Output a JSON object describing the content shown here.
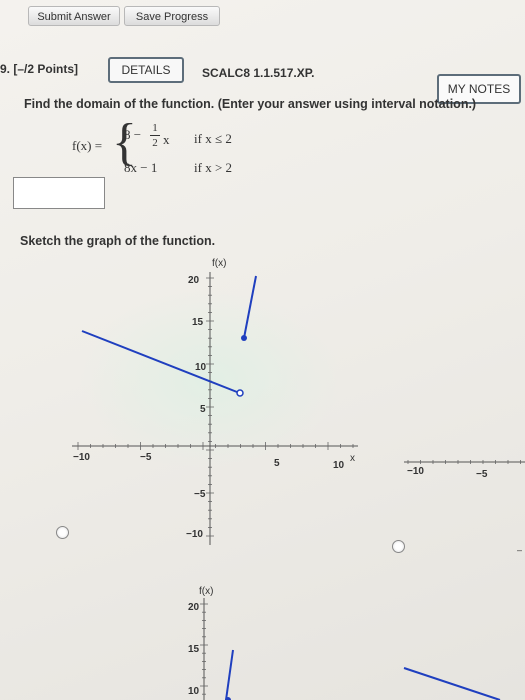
{
  "toolbar": {
    "submit_label": "Submit Answer",
    "save_label": "Save Progress"
  },
  "question": {
    "number": "9. [–/2 Points]",
    "details_label": "DETAILS",
    "code": "SCALC8 1.1.517.XP.",
    "my_notes_label": "MY NOTES",
    "prompt": "Find the domain of the function. (Enter your answer using interval notation.)",
    "function_name": "f(x) =",
    "piece1_expr": "8 −",
    "piece1_frac_num": "1",
    "piece1_frac_den": "2",
    "piece1_var": "x",
    "piece1_cond": "if x ≤ 2",
    "piece2_expr": "8x − 1",
    "piece2_cond": "if x > 2",
    "answer_value": "",
    "sketch_prompt": "Sketch the graph of the function."
  },
  "graph_main": {
    "ylabel": "f(x)",
    "xlabel": "x",
    "x_ticks": [
      "−10",
      "−5",
      "5",
      "10"
    ],
    "y_ticks": [
      "20",
      "15",
      "10",
      "5",
      "−5",
      "−10"
    ]
  },
  "graph_right": {
    "x_ticks": [
      "−10",
      "−5"
    ]
  },
  "graph_lower": {
    "ylabel": "f(x)",
    "y_ticks": [
      "20",
      "15",
      "10"
    ]
  },
  "colors": {
    "curve": "#1f3fbf",
    "axis": "#555555"
  },
  "chart_data": [
    {
      "type": "line",
      "title": "",
      "xlabel": "x",
      "ylabel": "f(x)",
      "xlim": [
        -11,
        12
      ],
      "ylim": [
        -12,
        21
      ],
      "series": [
        {
          "x": [
            -10,
            2
          ],
          "y": [
            13,
            7
          ],
          "endpoints": [
            "open-left",
            "open-circle-at-2"
          ]
        },
        {
          "x": [
            2.2,
            3
          ],
          "y": [
            13.5,
            20
          ],
          "endpoints": [
            "filled-circle",
            "arrow-up"
          ]
        }
      ]
    }
  ]
}
